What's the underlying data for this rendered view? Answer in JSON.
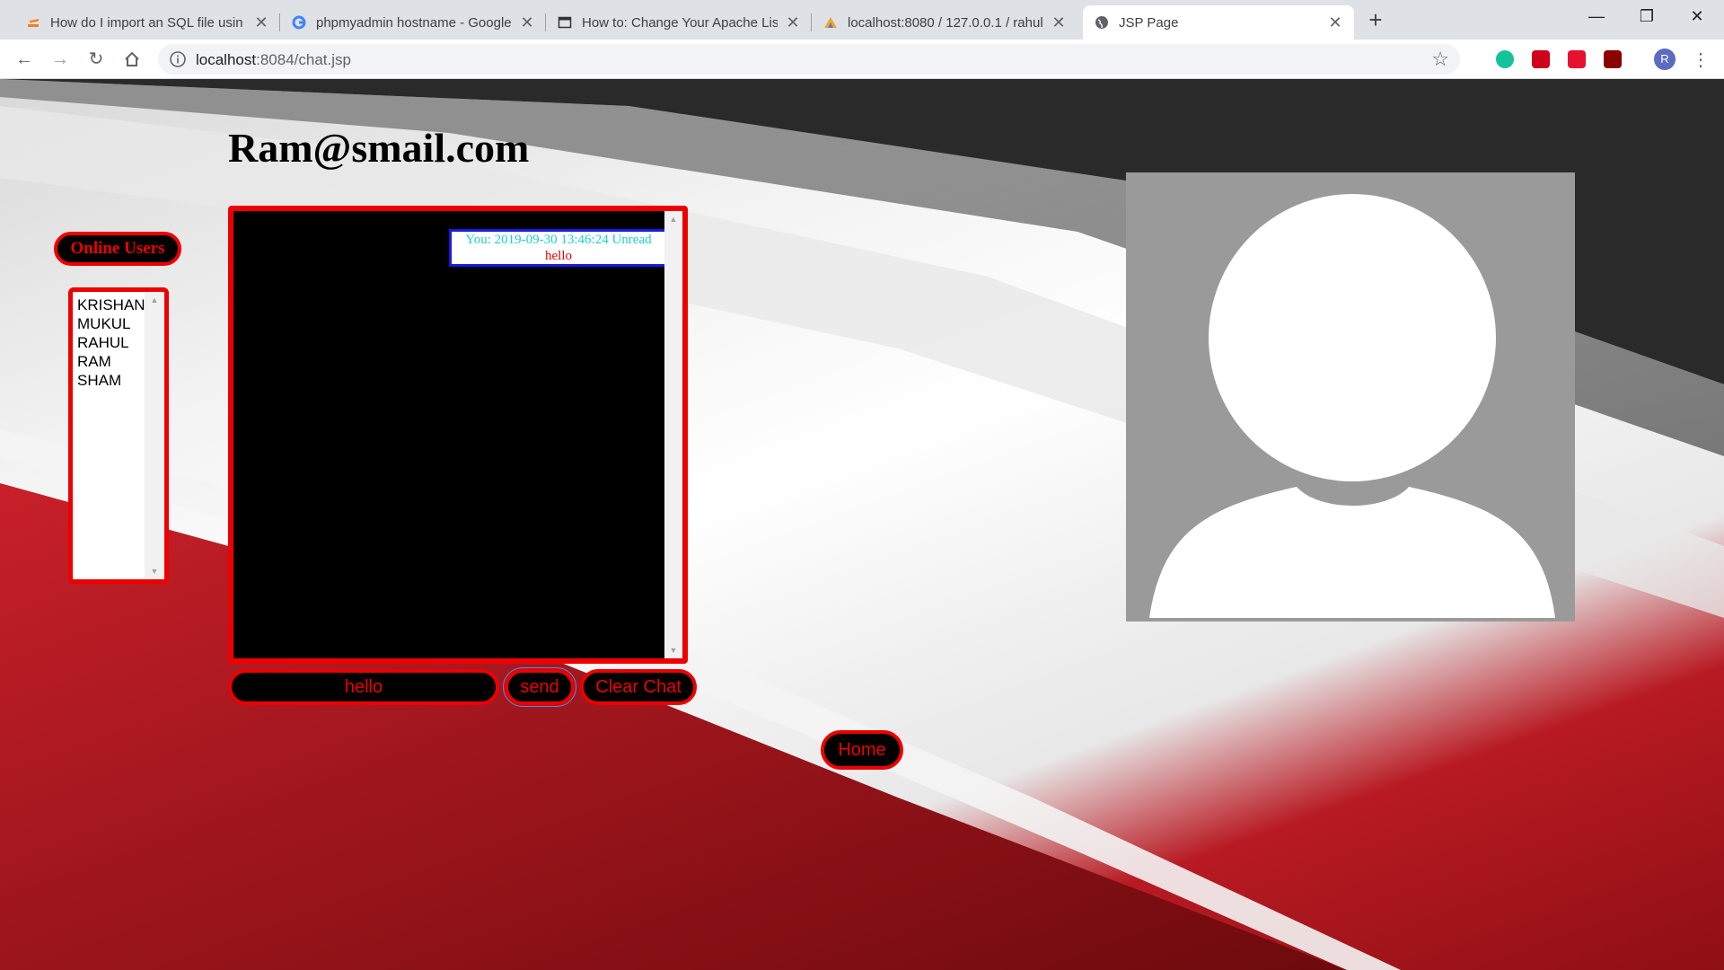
{
  "browser": {
    "tabs": [
      {
        "title": "How do I import an SQL file usin",
        "icon": "stack-icon"
      },
      {
        "title": "phpmyadmin hostname - Google",
        "icon": "google-icon"
      },
      {
        "title": "How to: Change Your Apache List",
        "icon": "page-icon"
      },
      {
        "title": "localhost:8080 / 127.0.0.1 / rahul",
        "icon": "phpmyadmin-icon"
      },
      {
        "title": "JSP Page",
        "icon": "globe-icon",
        "active": true
      }
    ],
    "url_host": "localhost",
    "url_rest": ":8084/chat.jsp",
    "avatar_letter": "R"
  },
  "page": {
    "user_email": "Ram@smail.com",
    "online_users_label": "Online Users",
    "online_users": [
      "KRISHAN",
      "MUKUL",
      "RAHUL",
      "RAM",
      "SHAM"
    ],
    "messages": [
      {
        "meta": "You: 2019-09-30 13:46:24 Unread",
        "text": "hello"
      }
    ],
    "message_input_value": "hello",
    "send_label": "send",
    "clear_label": "Clear Chat",
    "home_label": "Home"
  },
  "colors": {
    "accent": "#ee0000",
    "chat_background": "#000000",
    "message_border": "#1a1adc",
    "message_meta": "#1ccfcf",
    "profile_background": "#9a9a9a"
  }
}
